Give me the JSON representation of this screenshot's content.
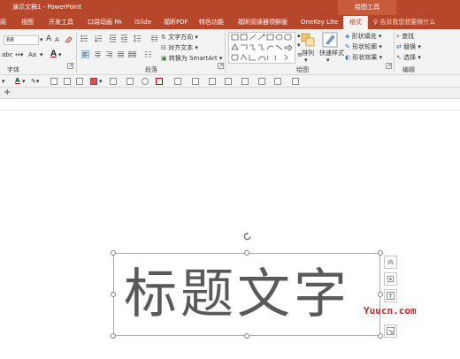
{
  "window": {
    "title": "演示文稿1 - PowerPoint",
    "context_group": "绘图工具"
  },
  "tabs": [
    {
      "label": "阅"
    },
    {
      "label": "视图"
    },
    {
      "label": "开发工具"
    },
    {
      "label": "口袋动画 PA"
    },
    {
      "label": "iSlide"
    },
    {
      "label": "福昕PDF"
    },
    {
      "label": "特色功能"
    },
    {
      "label": "福昕阅读器领鲜版"
    },
    {
      "label": "OneKey Lite"
    },
    {
      "label": "格式",
      "active": true
    }
  ],
  "tell_me": "告诉我您想要做什么",
  "ribbon": {
    "font": {
      "label": "字体",
      "size_value": "88",
      "increase_label": "A",
      "decrease_label": "A",
      "case_label": "Aa",
      "abc_label": "abc",
      "font_color_label": "A"
    },
    "paragraph": {
      "label": "段落",
      "text_direction": "文字方向",
      "align_text": "对齐文本",
      "convert_smartart": "转换为 SmartArt"
    },
    "drawing": {
      "label": "绘图",
      "arrange": "排列",
      "quick_styles": "快速样式",
      "shape_fill": "形状填充",
      "shape_outline": "形状轮廓",
      "shape_effects": "形状效果"
    },
    "editing": {
      "label": "编辑",
      "find": "查找",
      "replace": "替换",
      "select": "选择"
    }
  },
  "quick_toolbar": {
    "font_color_label": "A"
  },
  "thumbs": {
    "add_label": "+"
  },
  "slide": {
    "title_text": "标题文字"
  },
  "watermark": "Yuucn.com",
  "colors": {
    "accent": "#b7472a",
    "font_red": "#c00000"
  }
}
